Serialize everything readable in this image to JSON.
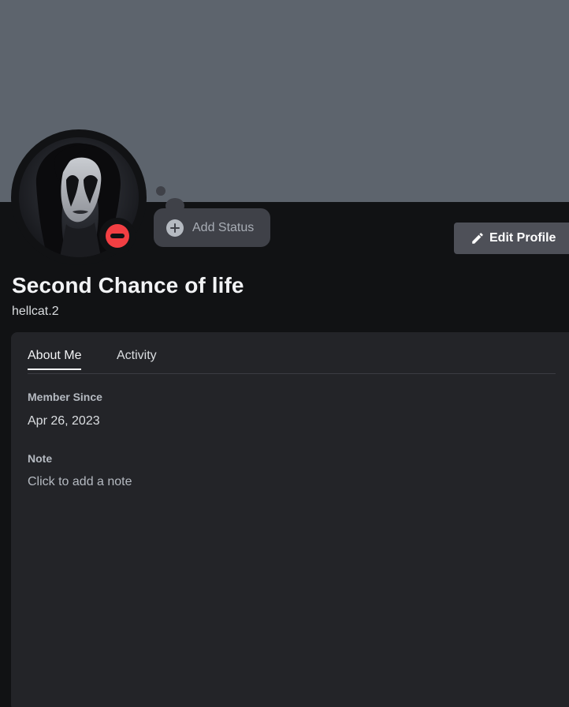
{
  "profile": {
    "display_name": "Second Chance of life",
    "username": "hellcat.2",
    "status": "do-not-disturb",
    "status_icon": "dnd-icon",
    "colors": {
      "banner": "#5d646d",
      "background": "#111214",
      "card": "#232428",
      "status_dnd": "#f23f43"
    }
  },
  "actions": {
    "add_status_label": "Add Status",
    "add_status_icon": "plus-circle-icon",
    "edit_profile_label": "Edit Profile",
    "edit_profile_icon": "pencil-icon"
  },
  "tabs": [
    {
      "label": "About Me",
      "active": true
    },
    {
      "label": "Activity",
      "active": false
    }
  ],
  "about": {
    "member_since_label": "Member Since",
    "member_since_value": "Apr 26, 2023",
    "note_label": "Note",
    "note_placeholder": "Click to add a note"
  }
}
